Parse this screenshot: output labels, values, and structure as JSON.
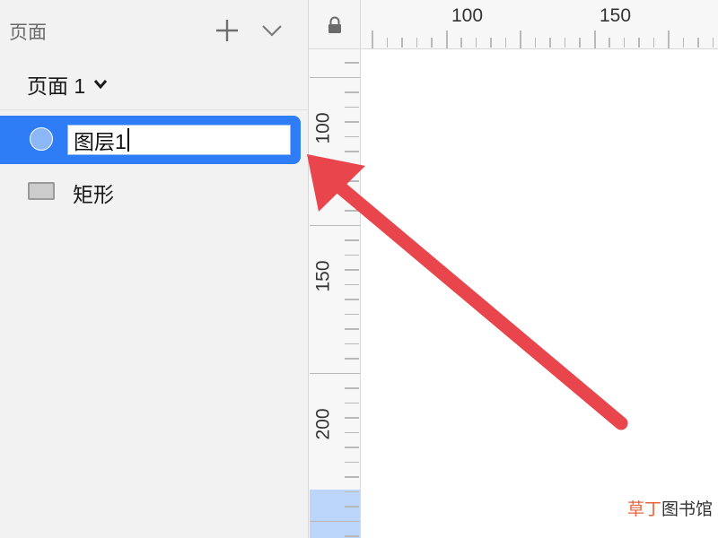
{
  "sidebar": {
    "title": "页面",
    "add_icon": "plus-icon",
    "collapse_icon": "chevron-down-icon",
    "page_selector": {
      "label": "页面 1",
      "icon": "chevron-down-icon"
    },
    "layers": [
      {
        "name": "图层1",
        "type": "oval",
        "icon": "circle-icon",
        "selected": true,
        "editing": true
      },
      {
        "name": "矩形",
        "type": "rectangle",
        "icon": "rectangle-icon",
        "selected": false,
        "editing": false
      }
    ]
  },
  "ruler": {
    "lock_icon": "lock-icon",
    "horizontal_labels": [
      "100",
      "150"
    ],
    "vertical_labels": [
      "100",
      "150",
      "200"
    ]
  },
  "colors": {
    "selection": "#2f7df6",
    "arrow": "#e8464c",
    "sidebar_bg": "#f2f2f2"
  },
  "watermark": {
    "part1": "草丁",
    "part2": "图书馆",
    "color1": "#e8643c",
    "color2": "#333333"
  }
}
